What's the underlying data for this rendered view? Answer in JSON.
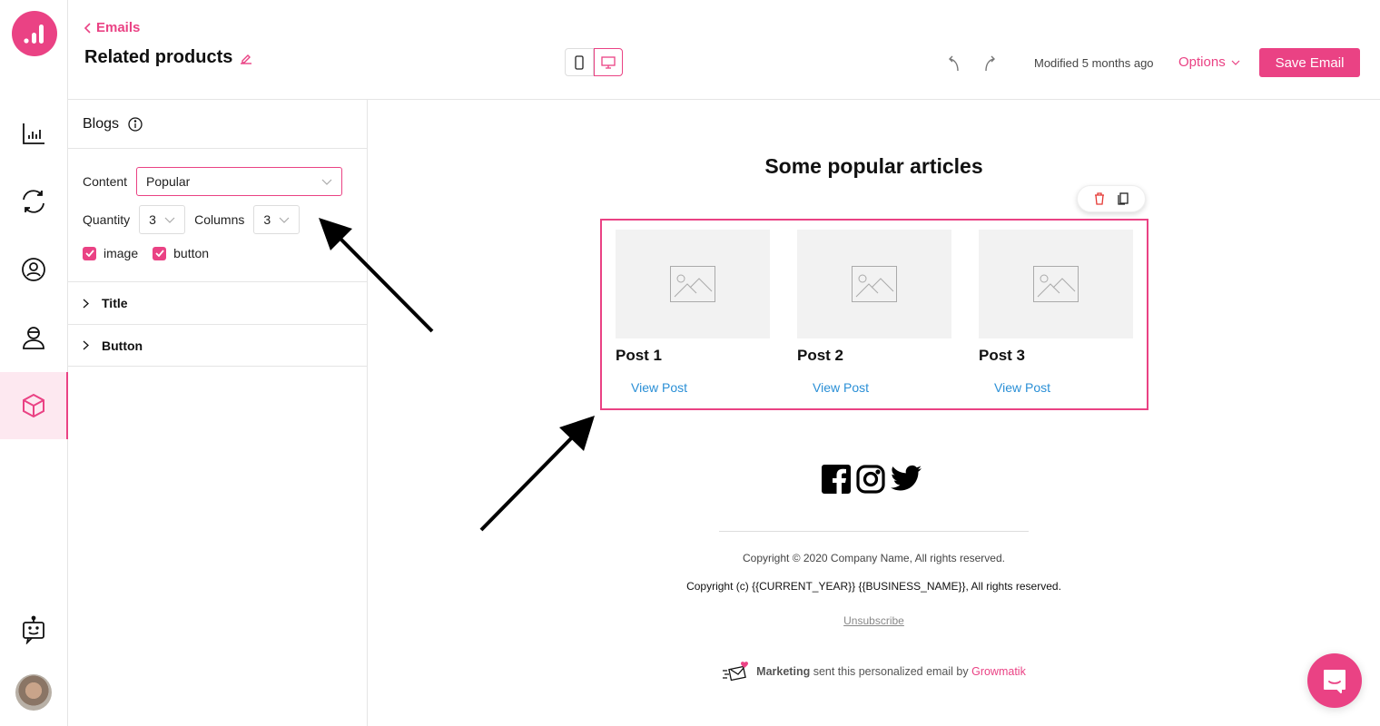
{
  "app": {
    "brand_color": "#ea4284"
  },
  "sidebar": {
    "items": [
      {
        "icon": "analytics-icon",
        "label": "Analytics",
        "active": false
      },
      {
        "icon": "sync-icon",
        "label": "Automations",
        "active": false
      },
      {
        "icon": "audience-icon",
        "label": "Audience",
        "active": false
      },
      {
        "icon": "customer-icon",
        "label": "Customers",
        "active": false
      },
      {
        "icon": "box-icon",
        "label": "Products",
        "active": true
      }
    ],
    "bottom": [
      {
        "icon": "bot-icon",
        "label": "Bot"
      },
      {
        "icon": "avatar",
        "label": "User"
      }
    ]
  },
  "header": {
    "back_label": "Emails",
    "title": "Related products",
    "modified": "Modified 5 months ago",
    "options_label": "Options",
    "save_label": "Save Email"
  },
  "panel": {
    "title": "Blogs",
    "content_label": "Content",
    "content_value": "Popular",
    "quantity_label": "Quantity",
    "quantity_value": "3",
    "columns_label": "Columns",
    "columns_value": "3",
    "checkboxes": [
      {
        "label": "image",
        "checked": true
      },
      {
        "label": "button",
        "checked": true
      }
    ],
    "sections": [
      {
        "label": "Title"
      },
      {
        "label": "Button"
      }
    ]
  },
  "email": {
    "heading": "Some popular articles",
    "posts": [
      {
        "title": "Post 1",
        "link": "View Post"
      },
      {
        "title": "Post 2",
        "link": "View Post"
      },
      {
        "title": "Post 3",
        "link": "View Post"
      }
    ],
    "copyright1": "Copyright © 2020 Company Name, All rights reserved.",
    "copyright2": "Copyright (c) {{CURRENT_YEAR}} {{BUSINESS_NAME}}, All rights reserved.",
    "unsubscribe": "Unsubscribe",
    "sender_bold": "Marketing",
    "sender_text": " sent this personalized email by ",
    "sender_brand": "Growmatik"
  }
}
